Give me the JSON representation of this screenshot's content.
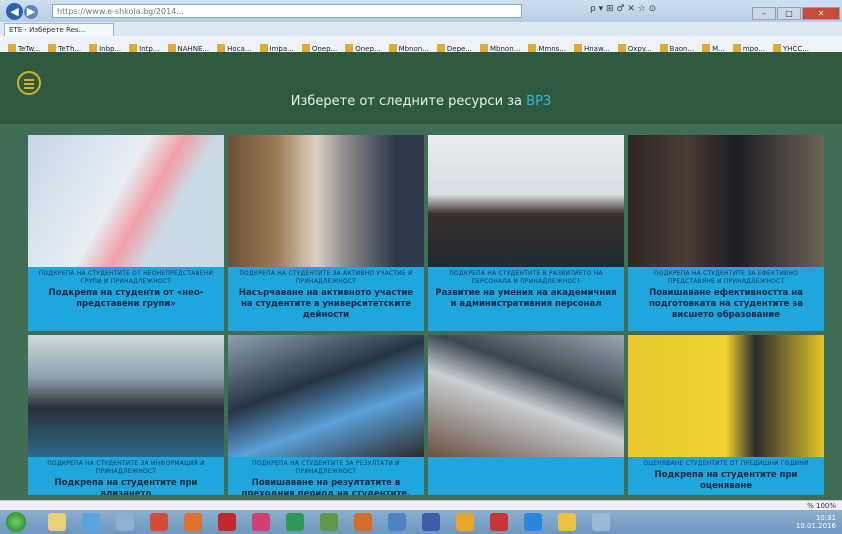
{
  "browser": {
    "address": "https://www.e-shkola.bg/2014...",
    "search_icons": "ρ ▾ ⊞ ♂ ✕   ☆ ⊙",
    "tab_label": "ETE - Изберете Res...",
    "favorites": [
      "TeTw...",
      "TeTh...",
      "Inbp...",
      "Intp...",
      "NAHNE...",
      "Hoca...",
      "Impa...",
      "Onep...",
      "Onep...",
      "Mbnon...",
      "Depe...",
      "Mbnon...",
      "Mmns...",
      "Hnaw...",
      "Oxpy...",
      "Baon...",
      "M...",
      "mpo...",
      "YHCC..."
    ],
    "zoom": "% 100%"
  },
  "header": {
    "title_prefix": "Изберете от следните ресурси за",
    "title_accent": "ВРЗ"
  },
  "cards": [
    {
      "small": "ПОДКРЕПА НА СТУДЕНТИТЕ ОТ НЕОНЕПРЕДСТАВЕНИ ГРУПИ И ПРИНАДЛЕЖНОСТ",
      "big": "Подкрепа на студенти от «нео-представени групи»"
    },
    {
      "small": "ПОДКРЕПА НА СТУДЕНТИТЕ ЗА АКТИВНО УЧАСТИЕ И ПРИНАДЛЕЖНОСТ",
      "big": "Насърчаване на активното участие на студентите в университетските дейности"
    },
    {
      "small": "ПОДКРЕПА НА СТУДЕНТИТЕ В РАЗВИТИЕТО НА ПЕРСОНАЛА И ПРИНАДЛЕЖНОСТ",
      "big": "Развитие на умения на академичния и административния персонал"
    },
    {
      "small": "ПОДКРЕПА НА СТУДЕНТИТЕ ЗА ЕФЕКТИВНО ПРЕДСТАВЯНЕ И ПРИНАДЛЕЖНОСТ",
      "big": "Повишаване ефективността на подготовката на студентите за висшето образование"
    },
    {
      "small": "ПОДКРЕПА НА СТУДЕНТИТЕ ЗА ИНФОРМАЦИЯ И ПРИНАДЛЕЖНОСТ",
      "big": "Подкрепа на студентите при влизането"
    },
    {
      "small": "ПОДКРЕПА НА СТУДЕНТИТЕ ЗА РЕЗУЛТАТИ И ПРИНАДЛЕЖНОСТ",
      "big": "Повишаване на резултатите в преходния период на студентите, особено..."
    },
    {
      "small": "",
      "big": ""
    },
    {
      "small": "ОЦЕНЯВАНЕ СТУДЕНТИТЕ ОТ ПРЕДИШНИ ГОДИНИ",
      "big": "Подкрепа на студентите при оценяване"
    }
  ],
  "tray": {
    "time": "10:31",
    "date": "10.01.2016"
  },
  "colors": {
    "header_bg": "#2f5a3e",
    "page_bg": "#3f6d55",
    "caption_bg": "#1fa6dd",
    "accent": "#35b3e6",
    "menu_ring": "#d3b12a"
  }
}
